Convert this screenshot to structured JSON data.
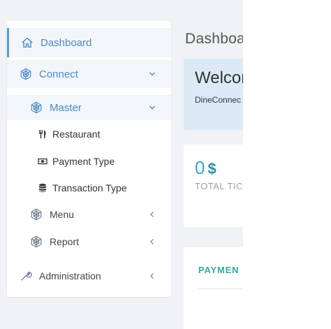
{
  "sidebar": {
    "dashboard": {
      "label": "Dashboard",
      "icon": "home-icon"
    },
    "connect": {
      "label": "Connect",
      "icon": "hexagon-icon"
    },
    "master": {
      "label": "Master",
      "icon": "hexagon-icon"
    },
    "restaurant": {
      "label": "Restaurant",
      "icon": "cutlery-icon"
    },
    "payment_type": {
      "label": "Payment Type",
      "icon": "money-icon"
    },
    "transaction_type": {
      "label": "Transaction Type",
      "icon": "database-icon"
    },
    "menu": {
      "label": "Menu",
      "icon": "hexagon-icon"
    },
    "report": {
      "label": "Report",
      "icon": "hexagon-icon"
    },
    "administration": {
      "label": "Administration",
      "icon": "wrench-icon"
    }
  },
  "main": {
    "title": "Dashboa",
    "welcome": {
      "title": "Welcom",
      "subtitle": "DineConnec"
    },
    "stat": {
      "value": "0",
      "unit": "$",
      "label": "TOTAL TIC"
    },
    "payment": {
      "title": "PAYMEN"
    }
  },
  "colors": {
    "accent": "#4a8ac8",
    "stat": "#3aa6c9",
    "payment_title": "#38a8a0",
    "welcome_bg": "#dce9f7",
    "app_bg": "#f0f2f5"
  }
}
